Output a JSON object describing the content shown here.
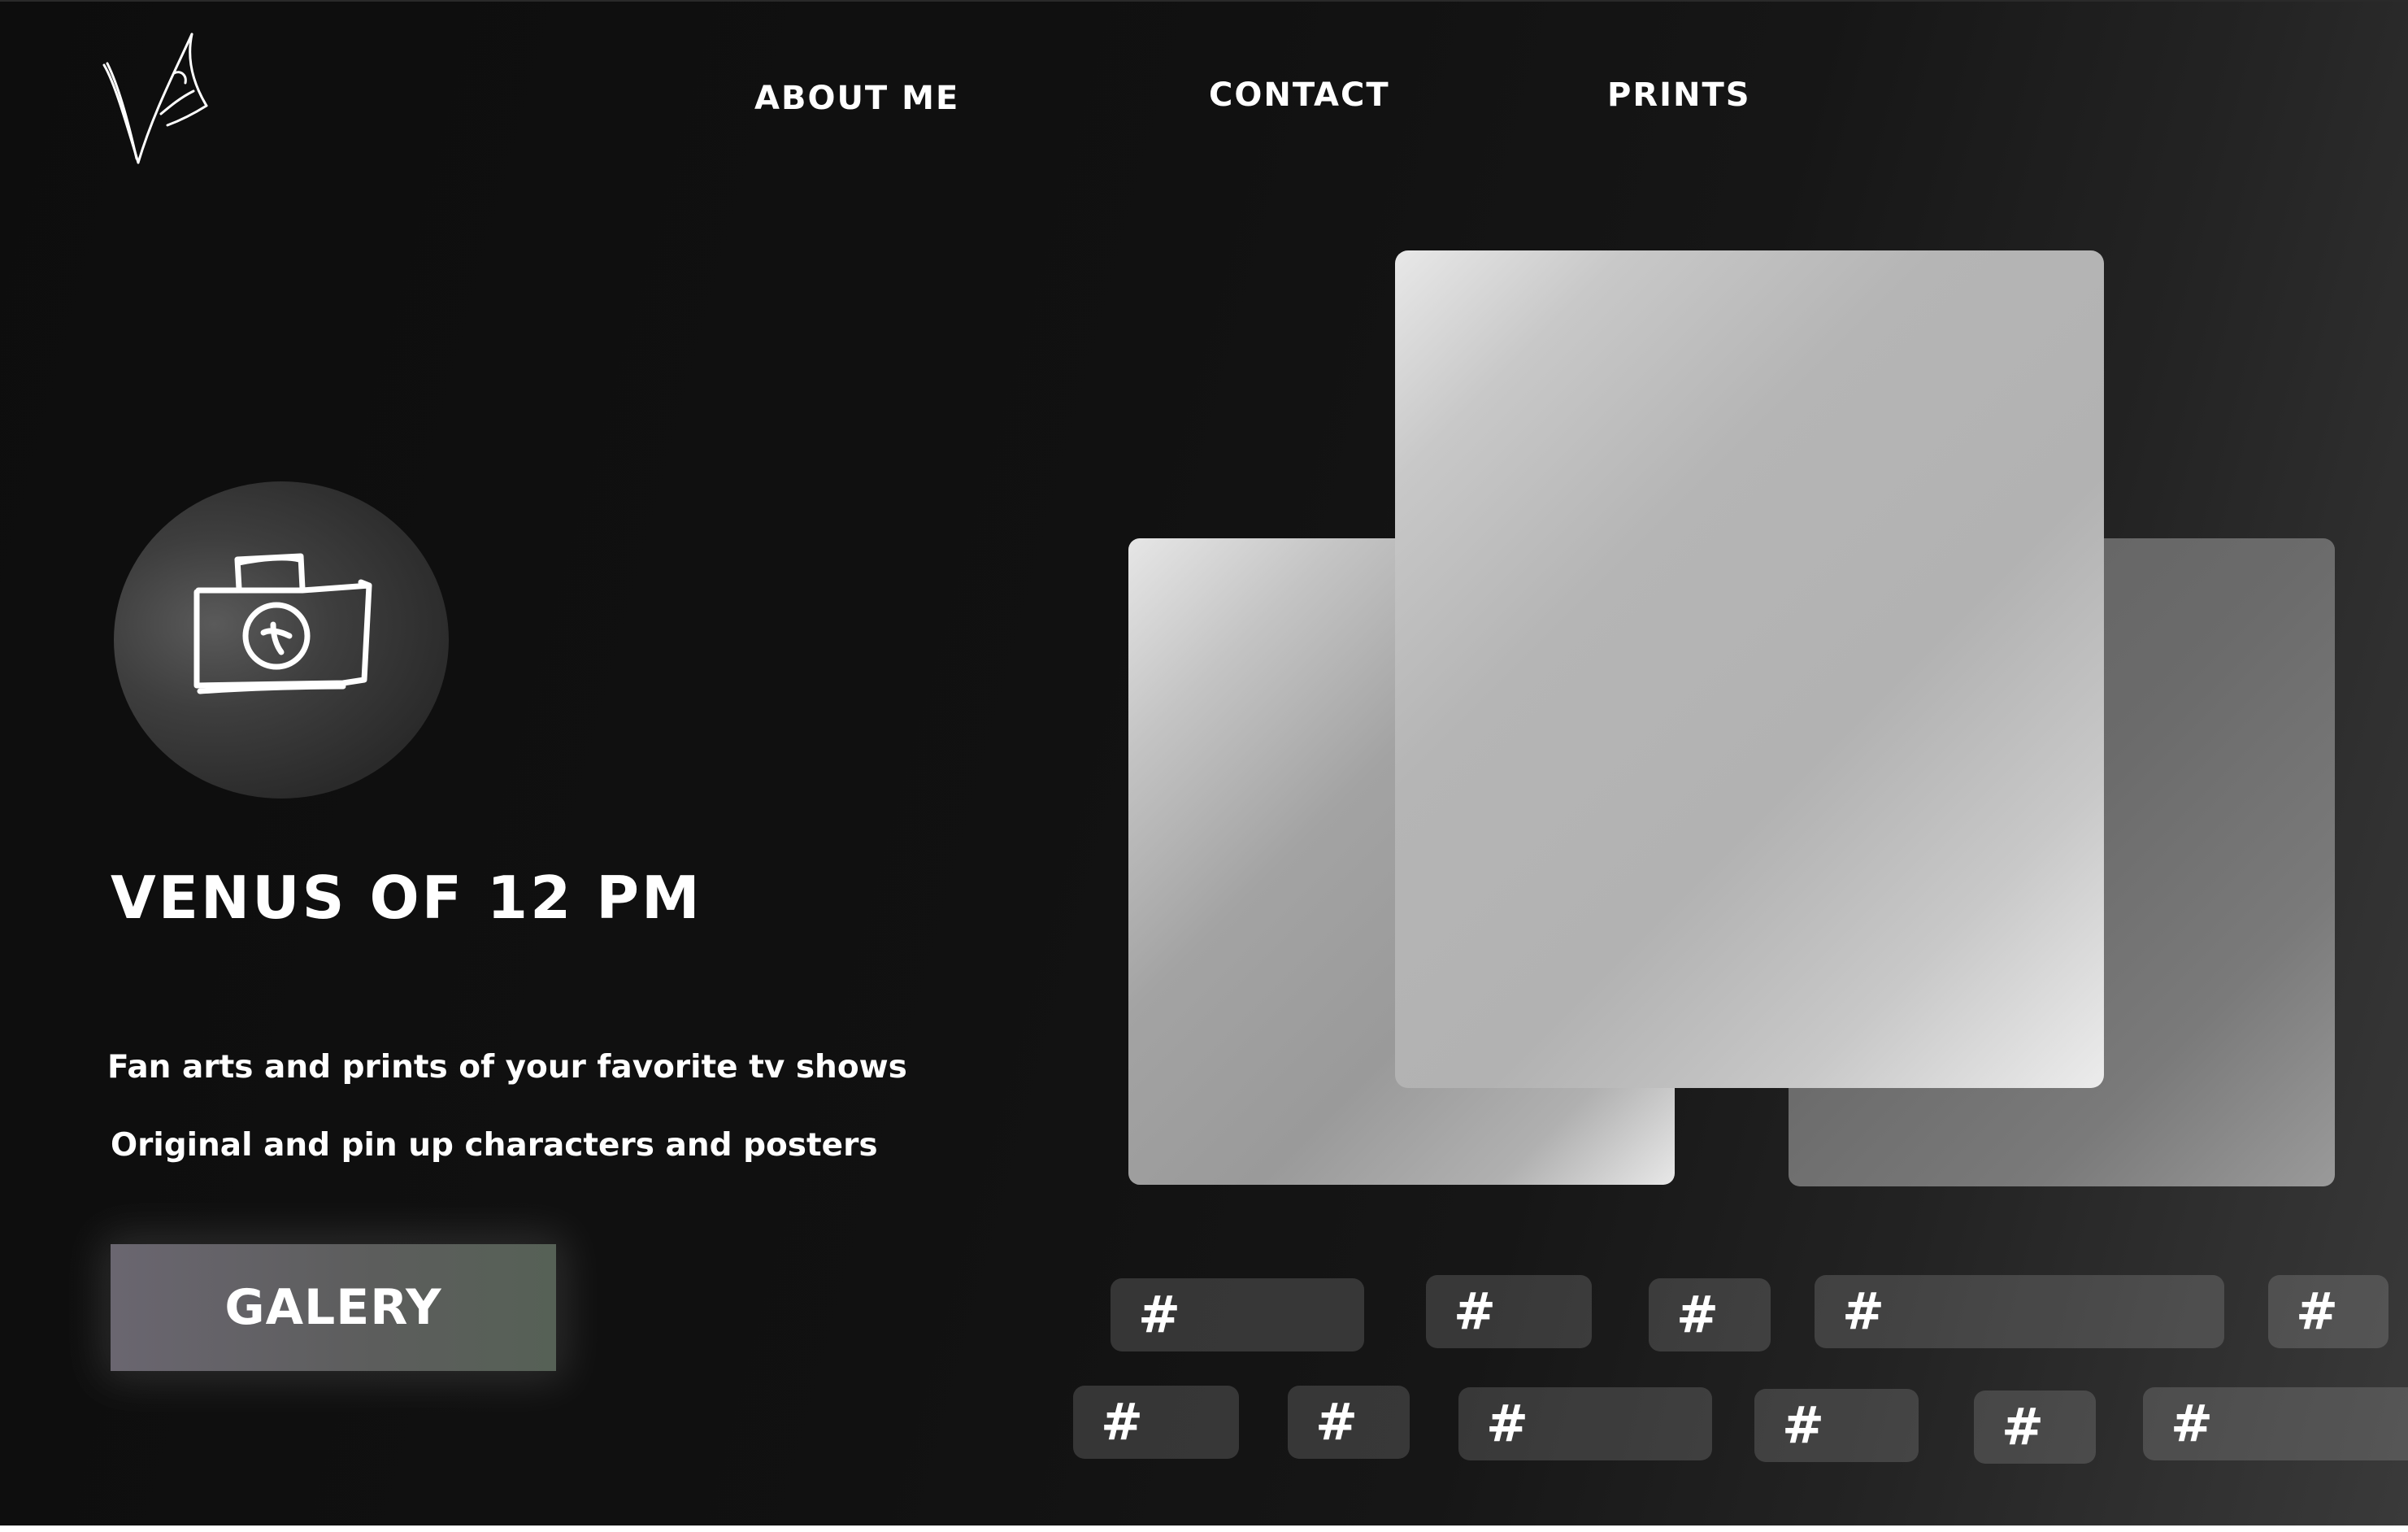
{
  "nav": {
    "about": "ABOUT ME",
    "contact": "CONTACT",
    "prints": "PRINTS"
  },
  "hero": {
    "title": "VENUS OF 12 PM",
    "tagline_1": "Fan arts and prints of your favorite tv shows",
    "tagline_2": "Original and pin up characters and posters",
    "button_label": "GALERY"
  },
  "tags": {
    "row1": [
      "#",
      "#",
      "#",
      "#",
      "#"
    ],
    "row2": [
      "#",
      "#",
      "#",
      "#",
      "#",
      "#"
    ]
  },
  "colors": {
    "background": "#111111",
    "text": "#ffffff",
    "button": "#5e5f5e"
  },
  "icons": {
    "logo": "signature-logo-icon",
    "camera": "camera-icon"
  }
}
